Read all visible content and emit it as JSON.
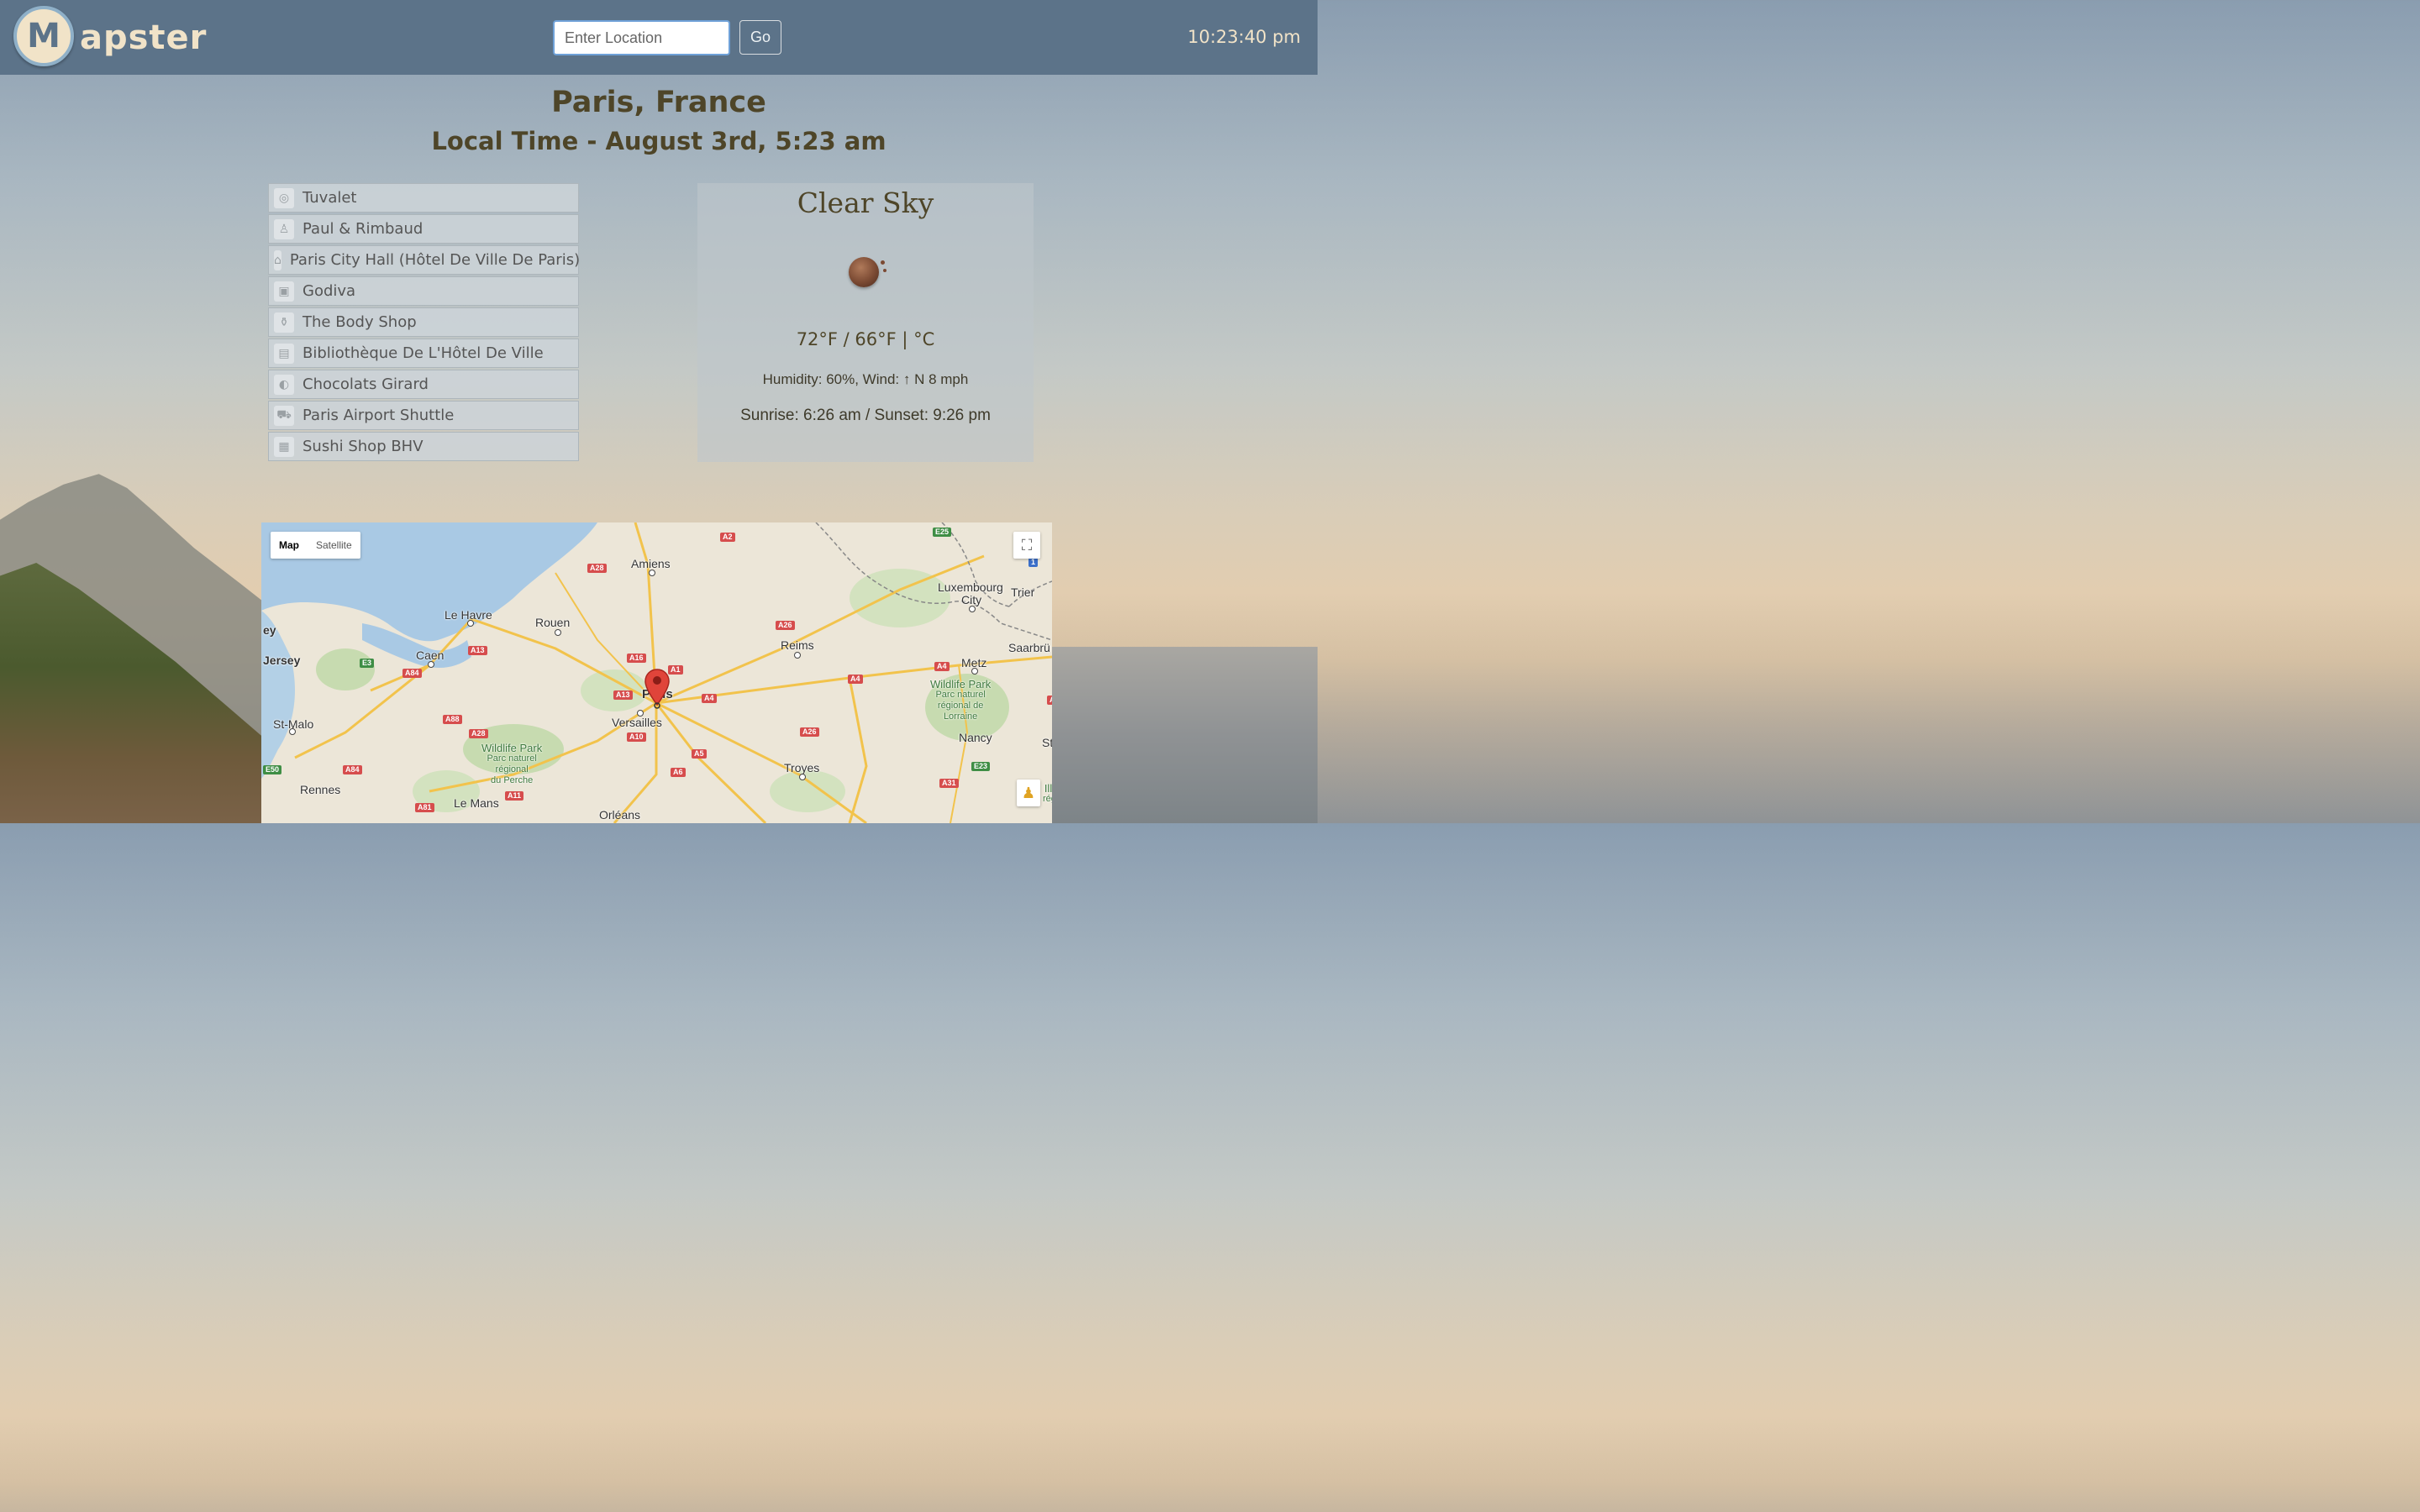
{
  "header": {
    "logo_letter": "M",
    "logo_text": "apster",
    "search": {
      "placeholder": "Enter Location",
      "value": ""
    },
    "go_label": "Go",
    "clock": "10:23:40 pm"
  },
  "location": {
    "title": "Paris, France",
    "local_time": "Local Time - August 3rd, 5:23 am"
  },
  "places": [
    {
      "label": "Tuvalet",
      "icon": "circle-icon",
      "glyph": "◎"
    },
    {
      "label": "Paul & Rimbaud",
      "icon": "eiffel-icon",
      "glyph": "♙"
    },
    {
      "label": "Paris City Hall (Hôtel De Ville De Paris)",
      "icon": "building-icon",
      "glyph": "⌂"
    },
    {
      "label": "Godiva",
      "icon": "gift-icon",
      "glyph": "▣"
    },
    {
      "label": "The Body Shop",
      "icon": "cosmetics-icon",
      "glyph": "⚱"
    },
    {
      "label": "Bibliothèque De L'Hôtel De Ville",
      "icon": "library-icon",
      "glyph": "▤"
    },
    {
      "label": "Chocolats Girard",
      "icon": "candy-icon",
      "glyph": "◐"
    },
    {
      "label": "Paris Airport Shuttle",
      "icon": "taxi-icon",
      "glyph": "⛟"
    },
    {
      "label": "Sushi Shop BHV",
      "icon": "restaurant-icon",
      "glyph": "▦"
    }
  ],
  "weather": {
    "condition": "Clear Sky",
    "icon": "moon-icon",
    "temperature": "72°F / 66°F | °C",
    "humidity_wind": "Humidity: 60%, Wind: ↑ N 8 mph",
    "sun": "Sunrise: 6:26 am / Sunset: 9:26 pm"
  },
  "map": {
    "type_map": "Map",
    "type_satellite": "Satellite",
    "cities": [
      "Amiens",
      "Le Havre",
      "Rouen",
      "Caen",
      "Jersey",
      "St-Malo",
      "Rennes",
      "Le Mans",
      "Orléans",
      "Versailles",
      "Paris",
      "Reims",
      "Troyes",
      "Nancy",
      "Metz",
      "Luxembourg",
      "City",
      "Trier",
      "Saarbrü",
      "ey",
      "St"
    ],
    "parks": [
      "Wildlife Park",
      "Parc naturel",
      "régional",
      "du Perche",
      "Wildlife Park",
      "Parc naturel",
      "régional de",
      "Lorraine",
      "Illi",
      "rég"
    ],
    "roads": [
      "A2",
      "A28",
      "E25",
      "1",
      "A26",
      "A16",
      "A1",
      "A13",
      "A13",
      "A4",
      "A4",
      "A4",
      "E3",
      "A84",
      "A88",
      "A28",
      "A10",
      "A5",
      "A6",
      "A26",
      "E50",
      "A84",
      "A81",
      "A11",
      "E23",
      "A31",
      "A4"
    ]
  }
}
